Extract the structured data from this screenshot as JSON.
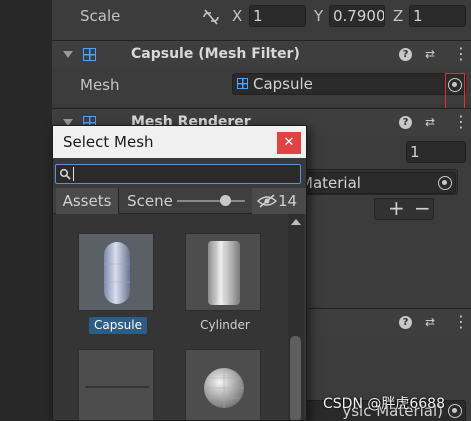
{
  "transform": {
    "scale_label": "Scale",
    "x_label": "X",
    "x_value": "1",
    "y_label": "Y",
    "y_value": "0.7900",
    "z_label": "Z",
    "z_value": "1"
  },
  "mesh_filter": {
    "title": "Capsule (Mesh Filter)",
    "mesh_label": "Mesh",
    "mesh_value": "Capsule"
  },
  "mesh_renderer": {
    "title": "Mesh Renderer",
    "size_value": "1",
    "material_value": "Material",
    "add_label": "+",
    "remove_label": "−",
    "physic_material_value": "ysic Material)"
  },
  "popup": {
    "title": "Select Mesh",
    "close_label": "✕",
    "search_value": "",
    "tab_assets": "Assets",
    "tab_scene": "Scene",
    "hidden_count": "14",
    "slider_level": 0.72,
    "items": [
      {
        "label": "Capsule",
        "selected": true,
        "shape": "capsule"
      },
      {
        "label": "Cylinder",
        "selected": false,
        "shape": "cylinder"
      },
      {
        "label": "",
        "selected": false,
        "shape": "plane"
      },
      {
        "label": "",
        "selected": false,
        "shape": "sphere"
      }
    ]
  },
  "watermark": "CSDN @胖虎6688",
  "colors": {
    "accent_blue": "#4aa3ff",
    "selection": "#2c5d87",
    "close_red": "#e04343",
    "highlight_box": "#e03030"
  }
}
